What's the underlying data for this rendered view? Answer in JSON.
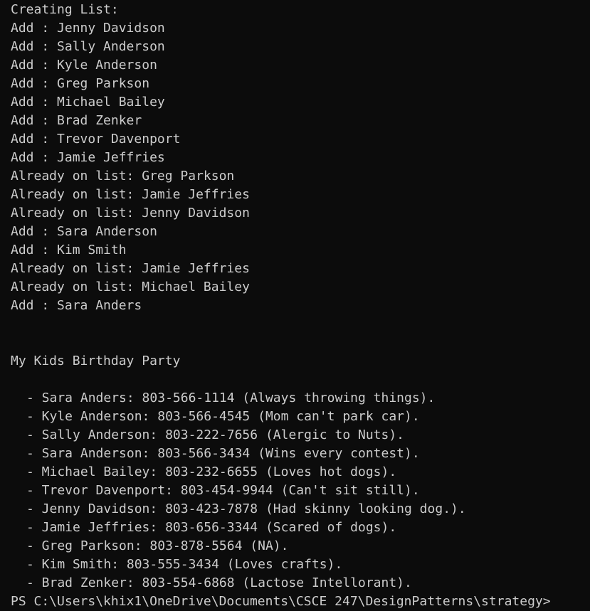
{
  "terminal": {
    "background": "#0c0c0c",
    "foreground": "#cccccc",
    "log_lines": [
      "Creating List:",
      "Add : Jenny Davidson",
      "Add : Sally Anderson",
      "Add : Kyle Anderson",
      "Add : Greg Parkson",
      "Add : Michael Bailey",
      "Add : Brad Zenker",
      "Add : Trevor Davenport",
      "Add : Jamie Jeffries",
      "Already on list: Greg Parkson",
      "Already on list: Jamie Jeffries",
      "Already on list: Jenny Davidson",
      "Add : Sara Anderson",
      "Add : Kim Smith",
      "Already on list: Jamie Jeffries",
      "Already on list: Michael Bailey",
      "Add : Sara Anders"
    ],
    "list_title": "My Kids Birthday Party",
    "list_items": [
      "- Sara Anders: 803-566-1114 (Always throwing things).",
      "- Kyle Anderson: 803-566-4545 (Mom can't park car).",
      "- Sally Anderson: 803-222-7656 (Alergic to Nuts).",
      "- Sara Anderson: 803-566-3434 (Wins every contest).",
      "- Michael Bailey: 803-232-6655 (Loves hot dogs).",
      "- Trevor Davenport: 803-454-9944 (Can't sit still).",
      "- Jenny Davidson: 803-423-7878 (Had skinny looking dog.).",
      "- Jamie Jeffries: 803-656-3344 (Scared of dogs).",
      "- Greg Parkson: 803-878-5564 (NA).",
      "- Kim Smith: 803-555-3434 (Loves crafts).",
      "- Brad Zenker: 803-554-6868 (Lactose Intellorant)."
    ],
    "prompt": "PS C:\\Users\\khix1\\OneDrive\\Documents\\CSCE 247\\DesignPatterns\\strategy>"
  }
}
